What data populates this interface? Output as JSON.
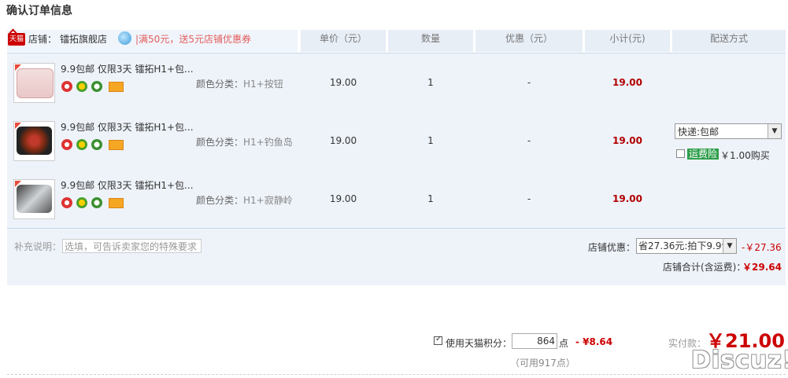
{
  "page": {
    "title": "确认订单信息"
  },
  "shop": {
    "label": "店铺：",
    "name": "镭拓旗舰店",
    "promo": "|满50元，送5元店铺优惠券",
    "logo_text": "天猫"
  },
  "columns": {
    "price": "单价（元）",
    "qty": "数量",
    "discount": "优惠（元）",
    "subtotal": "小计(元)",
    "shipping": "配送方式"
  },
  "items": [
    {
      "title": "9.9包邮 仅限3天 镭拓H1+包...",
      "sku_label": "颜色分类：",
      "sku_value": "H1+按钮",
      "price": "19.00",
      "qty": "1",
      "discount": "-",
      "subtotal": "19.00",
      "image": "white-keyboard-mousepad",
      "badges": [
        "seven-day-return-icon",
        "flower-icon",
        "genuine-icon",
        "credit-card-icon"
      ]
    },
    {
      "title": "9.9包邮 仅限3天 镭拓H1+包...",
      "sku_label": "颜色分类：",
      "sku_value": "H1+钓鱼岛",
      "price": "19.00",
      "qty": "1",
      "discount": "-",
      "subtotal": "19.00",
      "image": "red-dragon-mousepad",
      "badges": [
        "seven-day-return-icon",
        "flower-icon",
        "genuine-icon",
        "credit-card-icon"
      ]
    },
    {
      "title": "9.9包邮 仅限3天 镭拓H1+包...",
      "sku_label": "颜色分类：",
      "sku_value": "H1+寂静岭",
      "price": "19.00",
      "qty": "1",
      "discount": "-",
      "subtotal": "19.00",
      "image": "grey-landscape-mousepad",
      "badges": [
        "seven-day-return-icon",
        "flower-icon",
        "genuine-icon",
        "credit-card-icon"
      ]
    }
  ],
  "shipping": {
    "selected": "快递:包邮",
    "insurance_badge": "运费险",
    "insurance_price": "￥1.00购买"
  },
  "remarks": {
    "label": "补充说明：",
    "placeholder": "选填，可告诉卖家您的特殊要求"
  },
  "shop_discount": {
    "label": "店铺优惠：",
    "selected": "省27.36元:拍下9.9包",
    "value": "-￥27.36"
  },
  "shop_total": {
    "label": "店铺合计(含运费)：",
    "value": "￥29.64"
  },
  "points": {
    "label": "使用天猫积分：",
    "value": "864",
    "unit": "点",
    "money": "- ¥8.64",
    "available": "（可用917点）",
    "checked": true
  },
  "payment": {
    "label": "实付款：",
    "value": "￥21.00"
  },
  "watermark": "Discuz!",
  "colors": {
    "price_red": "#b10000",
    "header_bg": "#e8eef6",
    "promo": "#e35d5d"
  }
}
